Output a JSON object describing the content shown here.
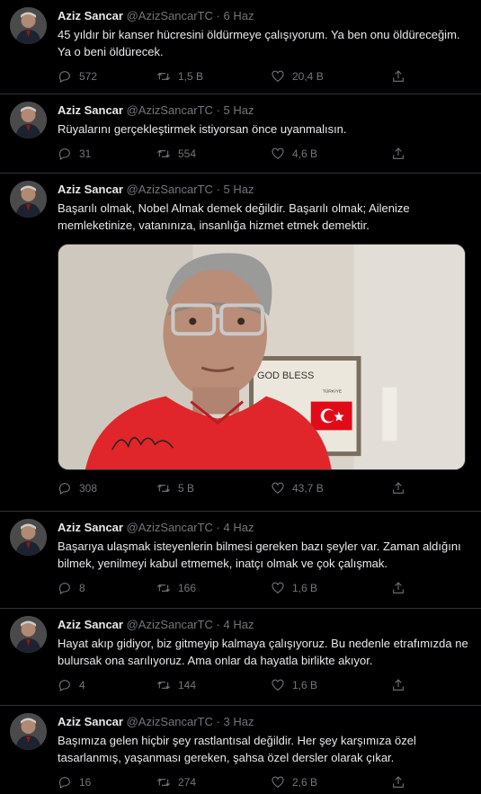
{
  "tweets": [
    {
      "name": "Aziz Sancar",
      "handle": "@AzizSancarTC",
      "date": "6 Haz",
      "text": "45 yıldır bir kanser hücresini öldürmeye çalışıyorum. Ya ben onu öldüreceğim. Ya o beni öldürecek.",
      "replies": "572",
      "retweets": "1,5 B",
      "likes": "20,4 B"
    },
    {
      "name": "Aziz Sancar",
      "handle": "@AzizSancarTC",
      "date": "5 Haz",
      "text": "Rüyalarını gerçekleştirmek istiyorsan önce uyanmalısın.",
      "replies": "31",
      "retweets": "554",
      "likes": "4,6 B"
    },
    {
      "name": "Aziz Sancar",
      "handle": "@AzizSancarTC",
      "date": "5 Haz",
      "text": "Başarılı olmak, Nobel Almak demek değildir. Başarılı olmak; Ailenize memleketinize, vatanınıza, insanlığa hizmet etmek demektir.",
      "media": {
        "frame_text": "GOD BLESS",
        "frame_subtext": "TÜRKİYE"
      },
      "replies": "308",
      "retweets": "5 B",
      "likes": "43,7 B"
    },
    {
      "name": "Aziz Sancar",
      "handle": "@AzizSancarTC",
      "date": "4 Haz",
      "text": "Başarıya ulaşmak isteyenlerin bilmesi gereken bazı şeyler var. Zaman aldığını bilmek, yenilmeyi kabul etmemek, inatçı olmak ve çok çalışmak.",
      "replies": "8",
      "retweets": "166",
      "likes": "1,6 B"
    },
    {
      "name": "Aziz Sancar",
      "handle": "@AzizSancarTC",
      "date": "4 Haz",
      "text": "Hayat akıp gidiyor, biz gitmeyip kalmaya çalışıyoruz. Bu nedenle etrafımızda ne bulursak ona sarılıyoruz. Ama onlar da hayatla birlikte akıyor.",
      "replies": "4",
      "retweets": "144",
      "likes": "1,6 B"
    },
    {
      "name": "Aziz Sancar",
      "handle": "@AzizSancarTC",
      "date": "3 Haz",
      "text": "Başımıza gelen hiçbir şey rastlantısal değildir. Her şey karşımıza özel tasarlanmış, yaşanması gereken, şahsa özel dersler olarak çıkar.",
      "replies": "16",
      "retweets": "274",
      "likes": "2,6 B"
    }
  ],
  "separator": "·",
  "icons": {
    "reply": "reply-icon",
    "retweet": "retweet-icon",
    "like": "heart-icon",
    "share": "share-icon"
  },
  "colors": {
    "background": "#000000",
    "text": "#e7e9ea",
    "muted": "#71767b",
    "border": "#2f3336"
  }
}
